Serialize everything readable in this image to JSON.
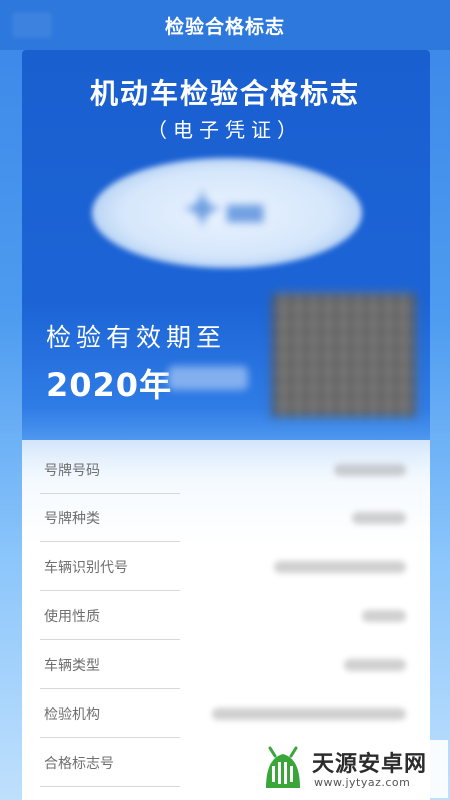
{
  "header": {
    "title": "检验合格标志"
  },
  "certificate": {
    "title": "机动车检验合格标志",
    "subtitle": "（电子凭证）",
    "valid_label": "检验有效期至",
    "valid_year": "2020年"
  },
  "details": {
    "rows": [
      {
        "label": "号牌号码"
      },
      {
        "label": "号牌种类"
      },
      {
        "label": "车辆识别代号"
      },
      {
        "label": "使用性质"
      },
      {
        "label": "车辆类型"
      },
      {
        "label": "检验机构"
      },
      {
        "label": "合格标志号"
      }
    ]
  },
  "watermark": {
    "name": "天源安卓网",
    "url": "www.jytyaz.com",
    "icon": "android-logo-icon"
  },
  "colors": {
    "header_bg": "#2d78dd",
    "card_bg": "#1c64d6",
    "watermark_green": "#3aa63a"
  }
}
